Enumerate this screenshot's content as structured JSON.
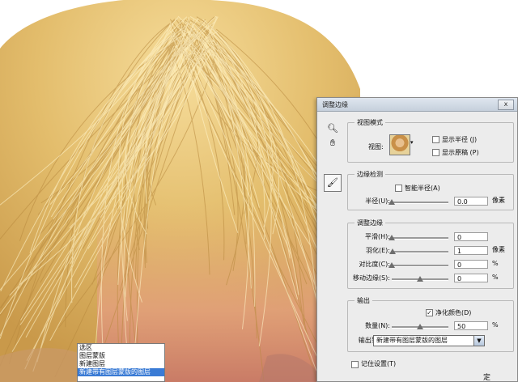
{
  "dialog": {
    "title": "调整边缘",
    "close_label": "x"
  },
  "tools": {
    "zoom_icon": "magnifier-icon",
    "hand_icon": "hand-icon",
    "brush_icon": "refine-radius-brush-icon"
  },
  "view_mode": {
    "title": "视图模式",
    "view_label": "视图:",
    "show_radius_label": "显示半径 (J)",
    "show_original_label": "显示原稿 (P)"
  },
  "edge_detection": {
    "title": "边缘检测",
    "smart_radius_label": "智能半径(A)",
    "radius_label": "半径(U):",
    "radius_value": "0.0",
    "radius_unit": "像素",
    "radius_level": 0
  },
  "adjust_edge": {
    "title": "调整边缘",
    "smooth_label": "平滑(H):",
    "smooth_value": "0",
    "smooth_level": 0,
    "feather_label": "羽化(E):",
    "feather_value": "1",
    "feather_unit": "像素",
    "feather_level": 0.02,
    "contrast_label": "对比度(C):",
    "contrast_value": "0",
    "contrast_unit": "%",
    "contrast_level": 0,
    "shift_label": "移动边缘(S):",
    "shift_value": "0",
    "shift_unit": "%",
    "shift_level": 0.5
  },
  "output": {
    "title": "输出",
    "decontaminate_label": "净化颜色(D)",
    "amount_label": "数量(N):",
    "amount_value": "50",
    "amount_unit": "%",
    "amount_level": 0.5,
    "output_to_label": "输出到(O):",
    "output_to_value": "新建带有图层蒙版的图层",
    "options": [
      "选区",
      "图层蒙版",
      "新建图层",
      "新建带有图层蒙版的图层"
    ],
    "selected_option_index": 3
  },
  "footer": {
    "remember_label": "记住设置(T)",
    "ok_fragment": "定"
  },
  "colors": {
    "hair_light": "#f2d48a",
    "hair_mid": "#d9b060",
    "skin": "#e8a27a",
    "selection": "#3a7bd5"
  }
}
